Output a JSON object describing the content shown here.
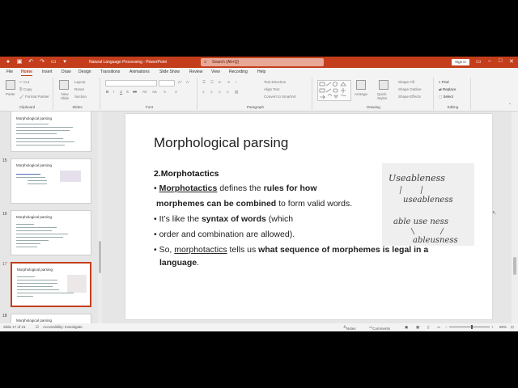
{
  "titlebar": {
    "doc_title": "Natural Language Processing  -  PowerPoint",
    "search_placeholder": "Search (Alt+Q)",
    "signin": "Sign in"
  },
  "menu": [
    "File",
    "Home",
    "Insert",
    "Draw",
    "Design",
    "Transitions",
    "Animations",
    "Slide Show",
    "Review",
    "View",
    "Recording",
    "Help"
  ],
  "ribbon": {
    "clipboard": {
      "paste": "Paste",
      "cut": "Cut",
      "copy": "Copy",
      "format_painter": "Format Painter",
      "label": "Clipboard"
    },
    "slides": {
      "new_slide": "New Slide",
      "layout": "Layout",
      "reset": "Reset",
      "section": "Section",
      "label": "Slides"
    },
    "font": {
      "label": "Font"
    },
    "paragraph": {
      "text_direction": "Text Direction",
      "align_text": "Align Text",
      "convert_smartart": "Convert to SmartArt",
      "label": "Paragraph"
    },
    "drawing": {
      "arrange": "Arrange",
      "quick_styles": "Quick Styles",
      "shape_fill": "Shape Fill",
      "shape_outline": "Shape Outline",
      "shape_effects": "Shape Effects",
      "label": "Drawing"
    },
    "editing": {
      "find": "Find",
      "replace": "Replace",
      "select": "Select",
      "label": "Editing"
    }
  },
  "thumbnails": [
    {
      "num": "",
      "title": "Morphological parsing"
    },
    {
      "num": "15",
      "title": "Morphological parsing"
    },
    {
      "num": "16",
      "title": "Morphological parsing"
    },
    {
      "num": "17",
      "title": "Morphological parsing"
    },
    {
      "num": "18",
      "title": "Morphological parsing"
    }
  ],
  "slide": {
    "title": "Morphological parsing",
    "heading": "2.Morphotactics",
    "b1_pre": "Morphotactics",
    "b1_mid": " defines the ",
    "b1_bold": "rules for how",
    "b2_bold": "morphemes can be combined",
    "b2_post": " to form valid words.",
    "b3_pre": "It’s like the ",
    "b3_bold": "syntax of words",
    "b3_post": " (which",
    "b4": "order and combination are allowed).",
    "b5_pre": "So, ",
    "b5_u": "morphotactics",
    "b5_mid": " tells us ",
    "b5_bold": "what sequence of morphemes is legal in a",
    "b6_bold": "language",
    "b6_post": ".",
    "handwriting": [
      "Useableness",
      "useableness",
      "able use ness",
      "ableusness"
    ]
  },
  "status": {
    "slide_of": "Slide 17 of 21",
    "accessibility": "Accessibility: Investigate",
    "notes": "Notes",
    "comments": "Comments",
    "zoom": "85%"
  }
}
